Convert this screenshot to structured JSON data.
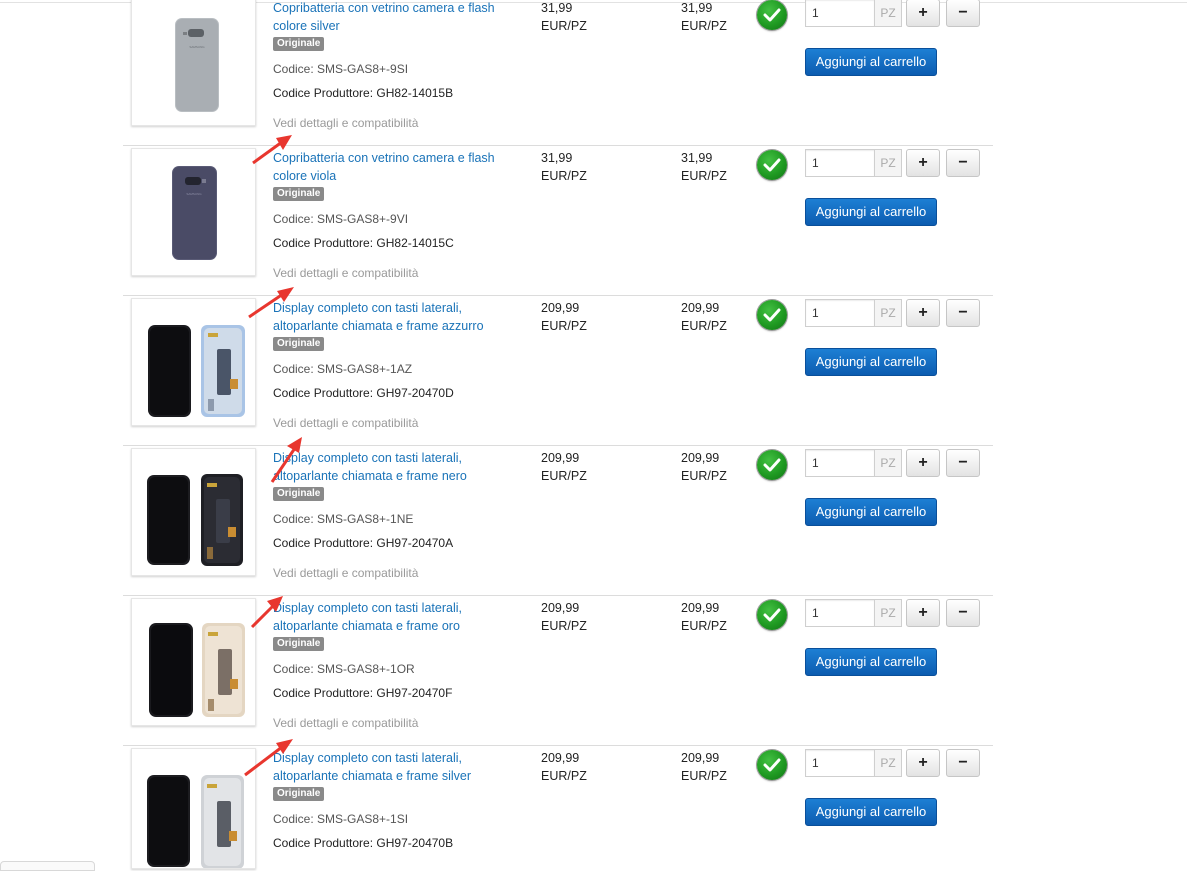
{
  "colors": {
    "link": "#1a73b8",
    "badge": "#8a8a8a",
    "cart_button": "#1470c4",
    "stock_ok": "#1f9a22",
    "annotation_arrow": "#e8362e"
  },
  "products": [
    {
      "title": "Copribatteria con vetrino camera e flash colore silver",
      "badge": "Originale",
      "code": "Codice: SMS-GAS8+-9SI",
      "producer_code": "Codice Produttore: GH82-14015B",
      "details_link": "Vedi dettagli e compatibilità",
      "price_1": "31,99",
      "price_1_unit": "EUR/PZ",
      "price_2": "31,99",
      "price_2_unit": "EUR/PZ",
      "availability_icon": "check-circle-icon",
      "quantity": "1",
      "unit": "PZ",
      "plus_label": "+",
      "minus_label": "−",
      "cart_label": "Aggiungi al carrello",
      "image": "samsung-back-cover-silver"
    },
    {
      "title": "Copribatteria con vetrino camera e flash colore viola",
      "badge": "Originale",
      "code": "Codice: SMS-GAS8+-9VI",
      "producer_code": "Codice Produttore: GH82-14015C",
      "details_link": "Vedi dettagli e compatibilità",
      "price_1": "31,99",
      "price_1_unit": "EUR/PZ",
      "price_2": "31,99",
      "price_2_unit": "EUR/PZ",
      "availability_icon": "check-circle-icon",
      "quantity": "1",
      "unit": "PZ",
      "plus_label": "+",
      "minus_label": "−",
      "cart_label": "Aggiungi al carrello",
      "image": "samsung-back-cover-violet"
    },
    {
      "title": "Display completo con tasti laterali, altoparlante chiamata e frame azzurro",
      "badge": "Originale",
      "code": "Codice: SMS-GAS8+-1AZ",
      "producer_code": "Codice Produttore: GH97-20470D",
      "details_link": "Vedi dettagli e compatibilità",
      "price_1": "209,99",
      "price_1_unit": "EUR/PZ",
      "price_2": "209,99",
      "price_2_unit": "EUR/PZ",
      "availability_icon": "check-circle-icon",
      "quantity": "1",
      "unit": "PZ",
      "plus_label": "+",
      "minus_label": "−",
      "cart_label": "Aggiungi al carrello",
      "image": "samsung-display-frame-blue"
    },
    {
      "title": "Display completo con tasti laterali, altoparlante chiamata e frame nero",
      "badge": "Originale",
      "code": "Codice: SMS-GAS8+-1NE",
      "producer_code": "Codice Produttore: GH97-20470A",
      "details_link": "Vedi dettagli e compatibilità",
      "price_1": "209,99",
      "price_1_unit": "EUR/PZ",
      "price_2": "209,99",
      "price_2_unit": "EUR/PZ",
      "availability_icon": "check-circle-icon",
      "quantity": "1",
      "unit": "PZ",
      "plus_label": "+",
      "minus_label": "−",
      "cart_label": "Aggiungi al carrello",
      "image": "samsung-display-frame-black"
    },
    {
      "title": "Display completo con tasti laterali, altoparlante chiamata e frame oro",
      "badge": "Originale",
      "code": "Codice: SMS-GAS8+-1OR",
      "producer_code": "Codice Produttore: GH97-20470F",
      "details_link": "Vedi dettagli e compatibilità",
      "price_1": "209,99",
      "price_1_unit": "EUR/PZ",
      "price_2": "209,99",
      "price_2_unit": "EUR/PZ",
      "availability_icon": "check-circle-icon",
      "quantity": "1",
      "unit": "PZ",
      "plus_label": "+",
      "minus_label": "−",
      "cart_label": "Aggiungi al carrello",
      "image": "samsung-display-frame-gold"
    },
    {
      "title": "Display completo con tasti laterali, altoparlante chiamata e frame silver",
      "badge": "Originale",
      "code": "Codice: SMS-GAS8+-1SI",
      "producer_code": "Codice Produttore: GH97-20470B",
      "details_link": "",
      "price_1": "209,99",
      "price_1_unit": "EUR/PZ",
      "price_2": "209,99",
      "price_2_unit": "EUR/PZ",
      "availability_icon": "check-circle-icon",
      "quantity": "1",
      "unit": "PZ",
      "plus_label": "+",
      "minus_label": "−",
      "cart_label": "Aggiungi al carrello",
      "image": "samsung-display-frame-silver"
    }
  ]
}
